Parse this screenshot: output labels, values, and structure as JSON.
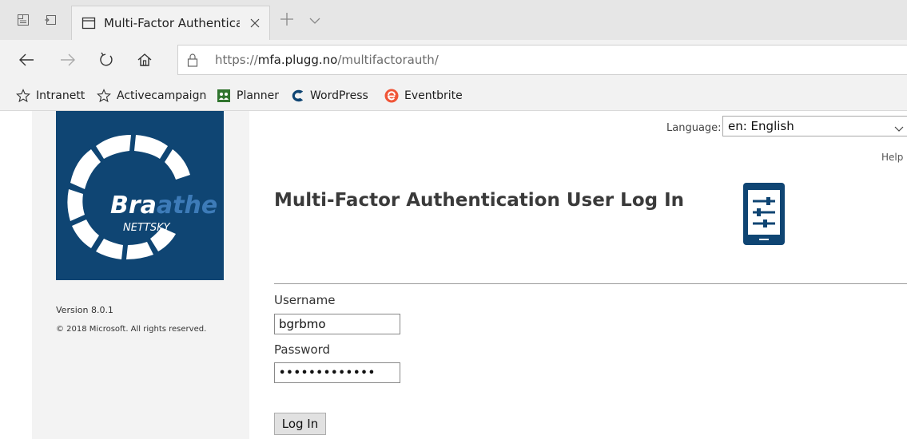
{
  "browser": {
    "tab": {
      "title": "Multi-Factor Authentica"
    },
    "address": {
      "scheme": "https://",
      "host": "mfa.plugg.no",
      "path": "/multifactorauth/"
    },
    "favorites": [
      {
        "label": "Intranett",
        "icon": "star-icon"
      },
      {
        "label": "Activecampaign",
        "icon": "star-icon"
      },
      {
        "label": "Planner",
        "icon": "planner-icon"
      },
      {
        "label": "WordPress",
        "icon": "wordpress-icon"
      },
      {
        "label": "Eventbrite",
        "icon": "eventbrite-icon"
      }
    ]
  },
  "sidebar": {
    "logo": {
      "brand_part1": "Bra",
      "brand_part2": "athe",
      "subtitle": "NETTSKY",
      "bg_color": "#0f4573"
    },
    "version": "Version 8.0.1",
    "copyright": "© 2018 Microsoft. All rights reserved."
  },
  "header": {
    "language_label": "Language:",
    "language_value": "en: English",
    "help_link": "Help",
    "title": "Multi-Factor Authentication User Log In",
    "device_icon": "mobile-settings-icon",
    "accent_color": "#0f4573"
  },
  "form": {
    "username_label": "Username",
    "username_value": "bgrbmo",
    "password_label": "Password",
    "password_value": "•••••••••••••",
    "login_button": "Log In"
  }
}
